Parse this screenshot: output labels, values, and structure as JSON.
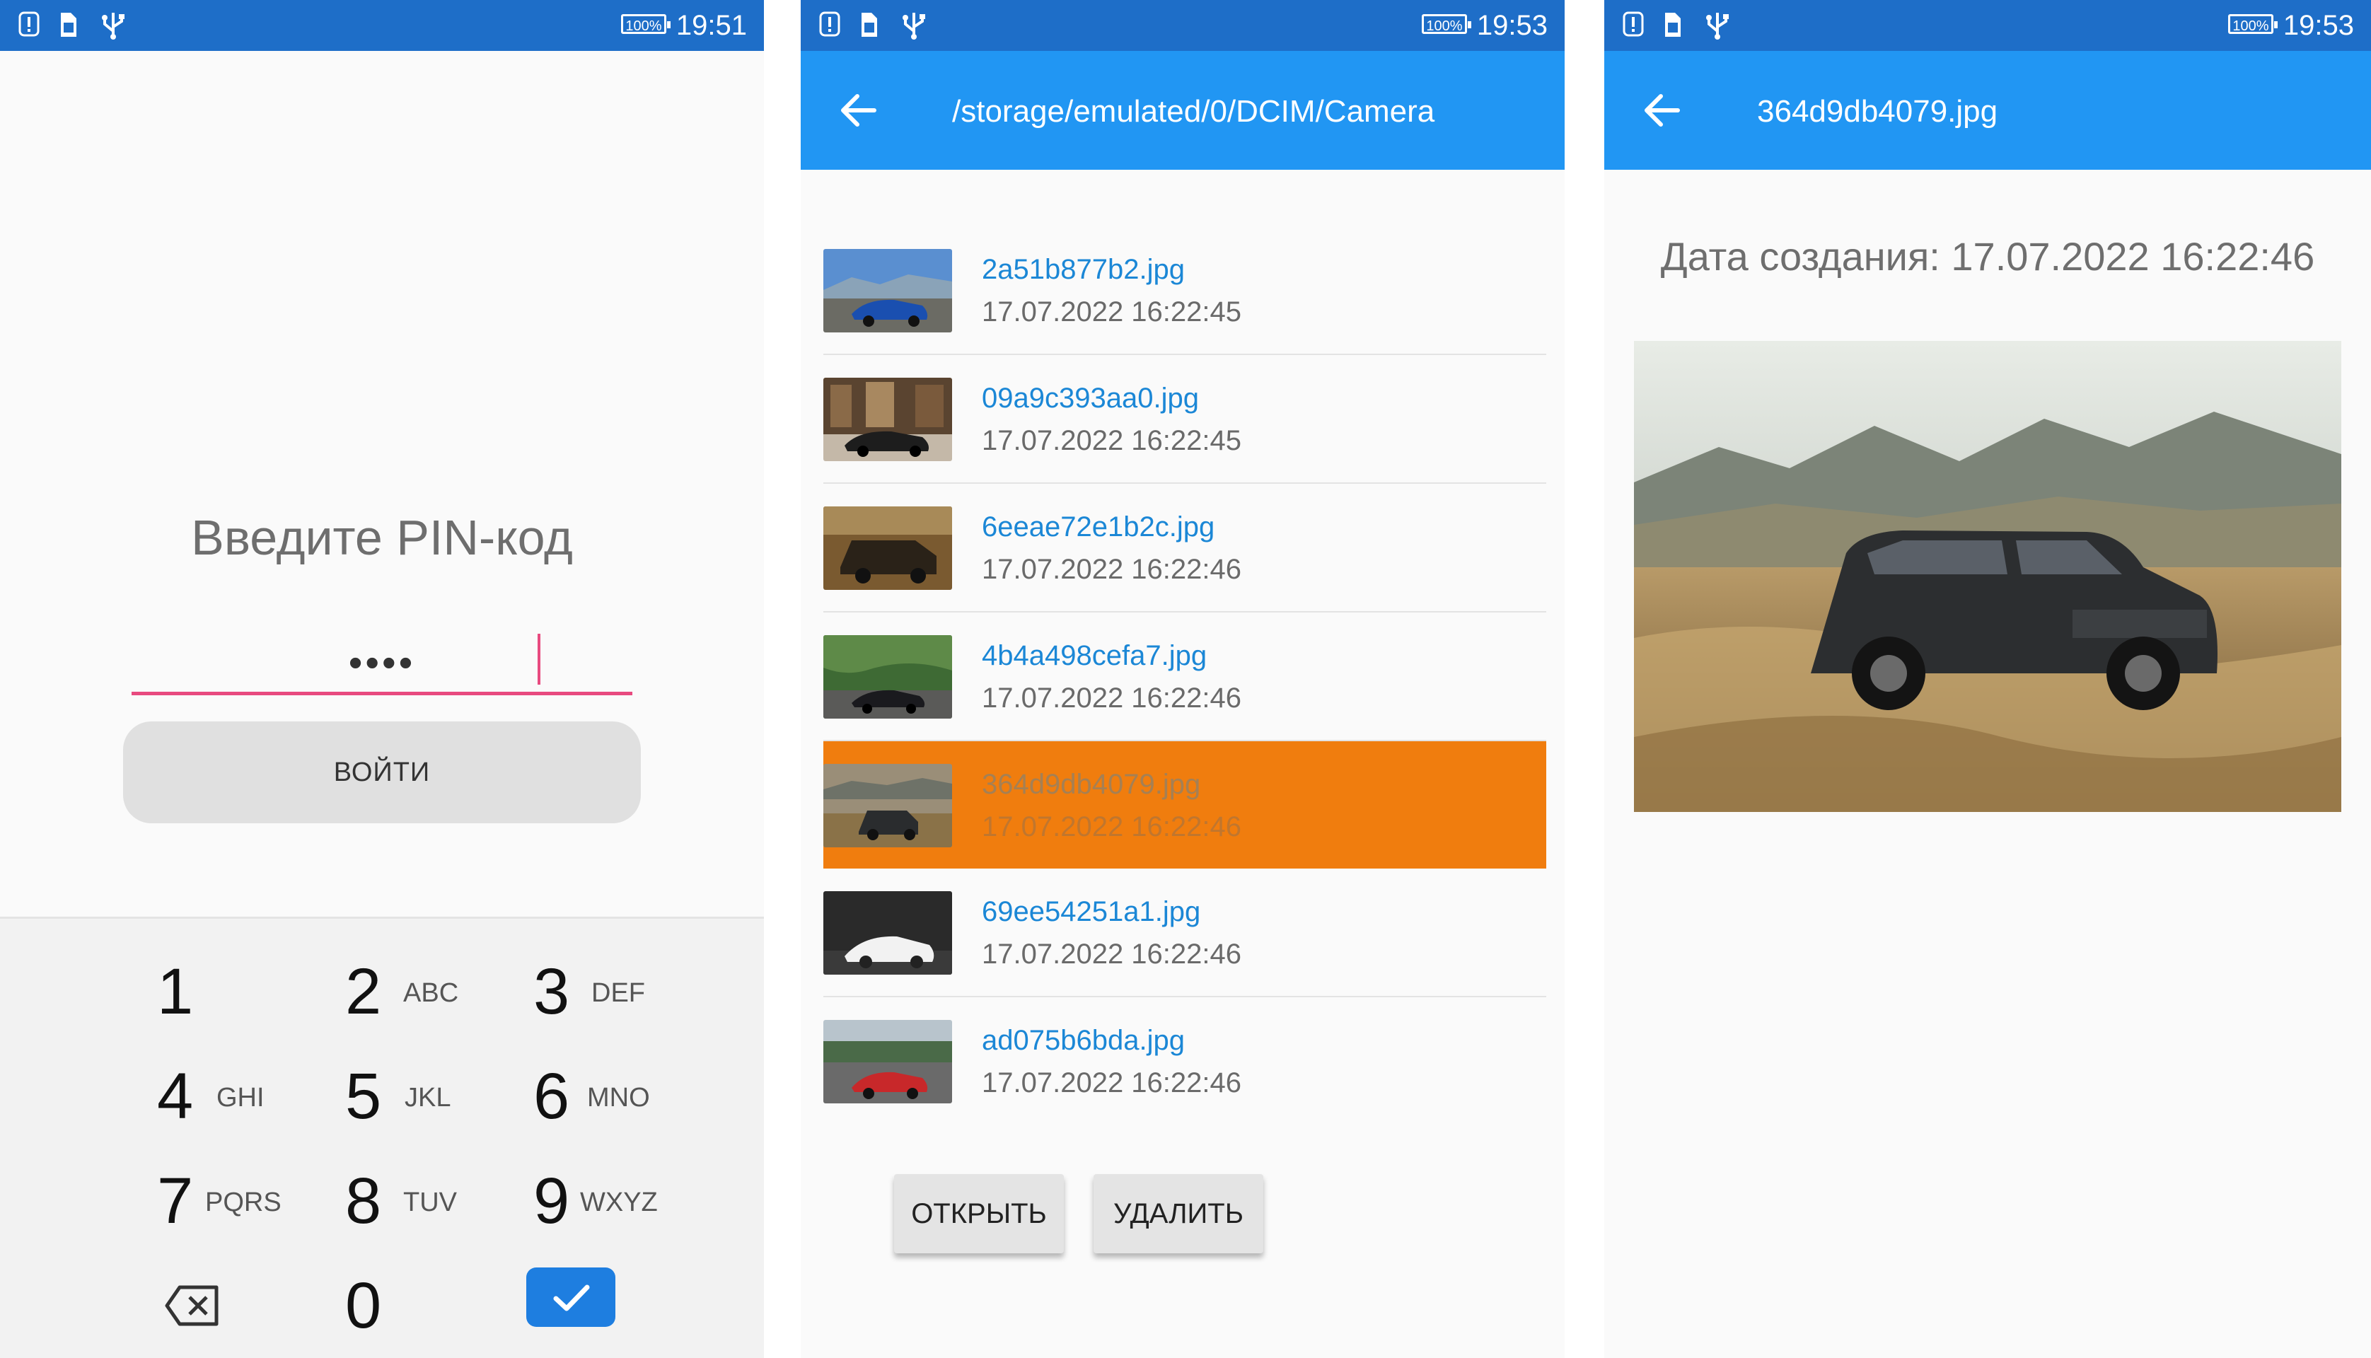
{
  "status_bar": {
    "battery": "100%",
    "screens": [
      {
        "time": "19:51"
      },
      {
        "time": "19:53"
      },
      {
        "time": "19:53"
      }
    ],
    "icons": [
      "alert-icon",
      "sim-icon",
      "usb-icon"
    ]
  },
  "pin_screen": {
    "title": "Введите PIN-код",
    "pin_value": "••••",
    "login_label": "ВОЙТИ",
    "accent": "#e84a7f",
    "keys": [
      {
        "num": "1",
        "letters": ""
      },
      {
        "num": "2",
        "letters": "ABC"
      },
      {
        "num": "3",
        "letters": "DEF"
      },
      {
        "num": "4",
        "letters": "GHI"
      },
      {
        "num": "5",
        "letters": "JKL"
      },
      {
        "num": "6",
        "letters": "MNO"
      },
      {
        "num": "7",
        "letters": "PQRS"
      },
      {
        "num": "8",
        "letters": "TUV"
      },
      {
        "num": "9",
        "letters": "WXYZ"
      },
      {
        "num": "0",
        "letters": ""
      }
    ],
    "icons": {
      "backspace": "backspace-icon",
      "confirm": "checkmark-icon"
    }
  },
  "browser_screen": {
    "path": "/storage/emulated/0/DCIM/Camera",
    "files": [
      {
        "name": "2a51b877b2.jpg",
        "date": "17.07.2022 16:22:45",
        "selected": false
      },
      {
        "name": "09a9c393aa0.jpg",
        "date": "17.07.2022 16:22:45",
        "selected": false
      },
      {
        "name": "6eeae72e1b2c.jpg",
        "date": "17.07.2022 16:22:46",
        "selected": false
      },
      {
        "name": "4b4a498cefa7.jpg",
        "date": "17.07.2022 16:22:46",
        "selected": false
      },
      {
        "name": "364d9db4079.jpg",
        "date": "17.07.2022 16:22:46",
        "selected": true
      },
      {
        "name": "69ee54251a1.jpg",
        "date": "17.07.2022 16:22:46",
        "selected": false
      },
      {
        "name": "ad075b6bda.jpg",
        "date": "17.07.2022 16:22:46",
        "selected": false
      }
    ],
    "open_label": "ОТКРЫТЬ",
    "delete_label": "УДАЛИТЬ",
    "selection_color": "#f07d0e"
  },
  "viewer_screen": {
    "title": "364d9db4079.jpg",
    "created": "Дата создания: 17.07.2022 16:22:46"
  },
  "colors": {
    "statusbar": "#1e6ec8",
    "appbar": "#2196f3",
    "link": "#1b87d6"
  }
}
